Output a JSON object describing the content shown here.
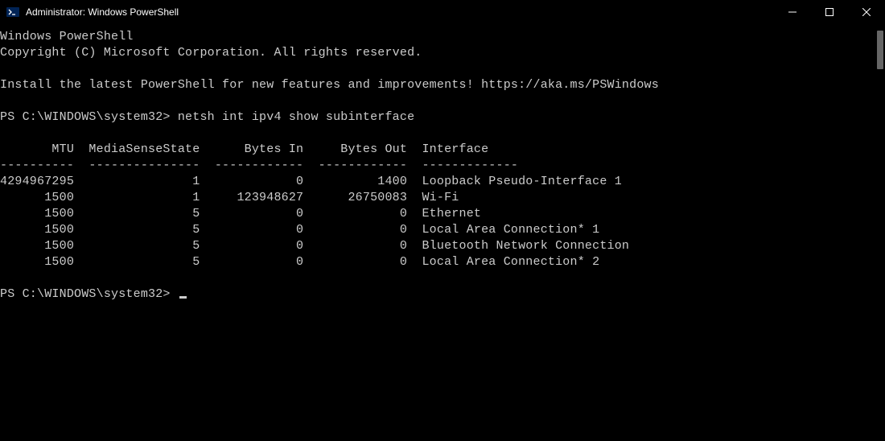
{
  "window": {
    "title": "Administrator: Windows PowerShell"
  },
  "terminal": {
    "banner_line1": "Windows PowerShell",
    "banner_line2": "Copyright (C) Microsoft Corporation. All rights reserved.",
    "install_msg": "Install the latest PowerShell for new features and improvements! https://aka.ms/PSWindows",
    "prompt1_prefix": "PS C:\\WINDOWS\\system32> ",
    "command1": "netsh int ipv4 show subinterface",
    "table_header": "       MTU  MediaSenseState      Bytes In     Bytes Out  Interface",
    "table_sep": "----------  ---------------  ------------  ------------  -------------",
    "rows": [
      {
        "mtu": "4294967295",
        "mss": "1",
        "bin": "0",
        "bout": "1400",
        "iface": "Loopback Pseudo-Interface 1"
      },
      {
        "mtu": "1500",
        "mss": "1",
        "bin": "123948627",
        "bout": "26750083",
        "iface": "Wi-Fi"
      },
      {
        "mtu": "1500",
        "mss": "5",
        "bin": "0",
        "bout": "0",
        "iface": "Ethernet"
      },
      {
        "mtu": "1500",
        "mss": "5",
        "bin": "0",
        "bout": "0",
        "iface": "Local Area Connection* 1"
      },
      {
        "mtu": "1500",
        "mss": "5",
        "bin": "0",
        "bout": "0",
        "iface": "Bluetooth Network Connection"
      },
      {
        "mtu": "1500",
        "mss": "5",
        "bin": "0",
        "bout": "0",
        "iface": "Local Area Connection* 2"
      }
    ],
    "prompt2_prefix": "PS C:\\WINDOWS\\system32> "
  }
}
